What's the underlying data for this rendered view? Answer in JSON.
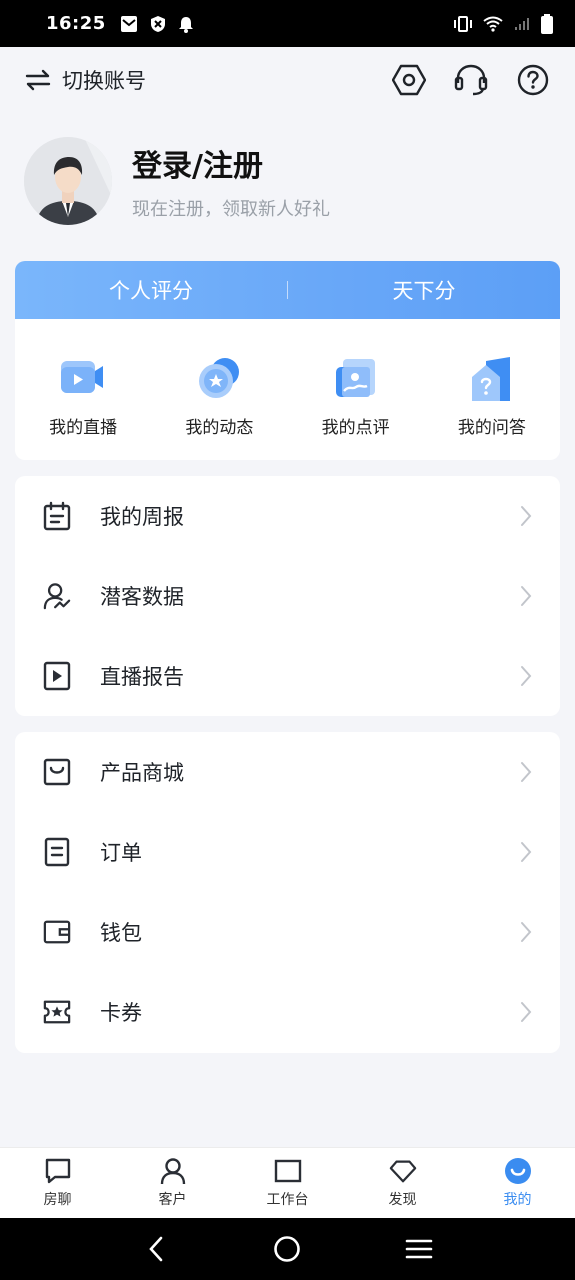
{
  "status_bar": {
    "time": "16:25"
  },
  "top_bar": {
    "switch_account_label": "切换账号"
  },
  "profile": {
    "title": "登录/注册",
    "subtitle": "现在注册，领取新人好礼"
  },
  "score_tabs": [
    "个人评分",
    "天下分"
  ],
  "quick_actions": [
    {
      "label": "我的直播",
      "icon": "live-video-icon"
    },
    {
      "label": "我的动态",
      "icon": "star-moments-icon"
    },
    {
      "label": "我的点评",
      "icon": "review-picture-icon"
    },
    {
      "label": "我的问答",
      "icon": "question-house-icon"
    }
  ],
  "group1": [
    {
      "label": "我的周报",
      "icon": "calendar-icon"
    },
    {
      "label": "潜客数据",
      "icon": "user-chart-icon"
    },
    {
      "label": "直播报告",
      "icon": "play-report-icon"
    }
  ],
  "group2": [
    {
      "label": "产品商城",
      "icon": "shopping-bag-icon"
    },
    {
      "label": "订单",
      "icon": "order-icon"
    },
    {
      "label": "钱包",
      "icon": "wallet-icon"
    },
    {
      "label": "卡券",
      "icon": "coupon-icon"
    }
  ],
  "bottom_nav": [
    {
      "label": "房聊",
      "icon": "chat-icon",
      "active": false
    },
    {
      "label": "客户",
      "icon": "person-icon",
      "active": false
    },
    {
      "label": "工作台",
      "icon": "workbench-icon",
      "active": false
    },
    {
      "label": "发现",
      "icon": "diamond-icon",
      "active": false
    },
    {
      "label": "我的",
      "icon": "me-smile-icon",
      "active": true
    }
  ],
  "colors": {
    "accent": "#3a8cf0",
    "banner": "#6aa9f8",
    "background": "#f4f5f9"
  }
}
